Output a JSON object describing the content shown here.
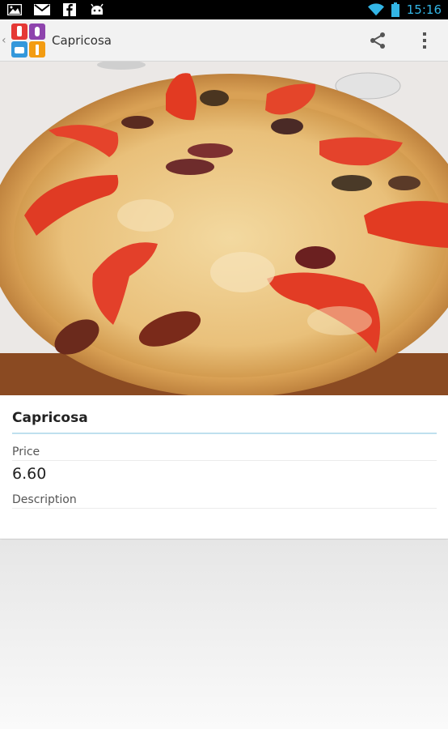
{
  "status_bar": {
    "icons_left": [
      "picture-icon",
      "gmail-icon",
      "facebook-icon",
      "android-icon"
    ],
    "icons_right": [
      "wifi-icon",
      "battery-icon"
    ],
    "time": "15:16"
  },
  "action_bar": {
    "title": "Capricosa",
    "actions": [
      "share-icon",
      "overflow-menu-icon"
    ]
  },
  "item": {
    "name": "Capricosa",
    "price_label": "Price",
    "price_value": "6.60",
    "description_label": "Description"
  },
  "colors": {
    "accent_blue": "#33b5e5",
    "underline": "#bfe0ee"
  }
}
